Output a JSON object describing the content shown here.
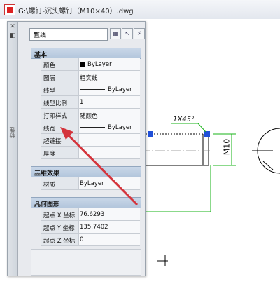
{
  "window": {
    "title": "G:\\螺钉-沉头螺钉（M10×40）.dwg"
  },
  "palette": {
    "strip_close": "✕",
    "strip_pin": "◧",
    "strip_title": "特性",
    "selector": "直线",
    "sections": {
      "basic": "基本",
      "three_d": "三维效果",
      "geometry": "几何图形"
    },
    "basic_rows": [
      {
        "label": "颜色",
        "value": "ByLayer"
      },
      {
        "label": "图层",
        "value": "粗实线"
      },
      {
        "label": "线型",
        "value": "ByLayer"
      },
      {
        "label": "线型比例",
        "value": "1"
      },
      {
        "label": "打印样式",
        "value": "随颜色"
      },
      {
        "label": "线宽",
        "value": "ByLayer"
      },
      {
        "label": "超链接",
        "value": ""
      },
      {
        "label": "厚度",
        "value": ""
      }
    ],
    "three_d_rows": [
      {
        "label": "材质",
        "value": "ByLayer"
      }
    ],
    "geometry_rows": [
      {
        "label": "起点 X 坐标",
        "value": "76.6293"
      },
      {
        "label": "起点 Y 坐标",
        "value": "135.7402"
      },
      {
        "label": "起点 Z 坐标",
        "value": "0"
      }
    ]
  },
  "drawing": {
    "chamfer_label": "1X45°",
    "dimension_label": "M10"
  },
  "colors": {
    "arrow": "#d4343c",
    "dimension": "#17b317",
    "grip": "#1f4fd8"
  }
}
